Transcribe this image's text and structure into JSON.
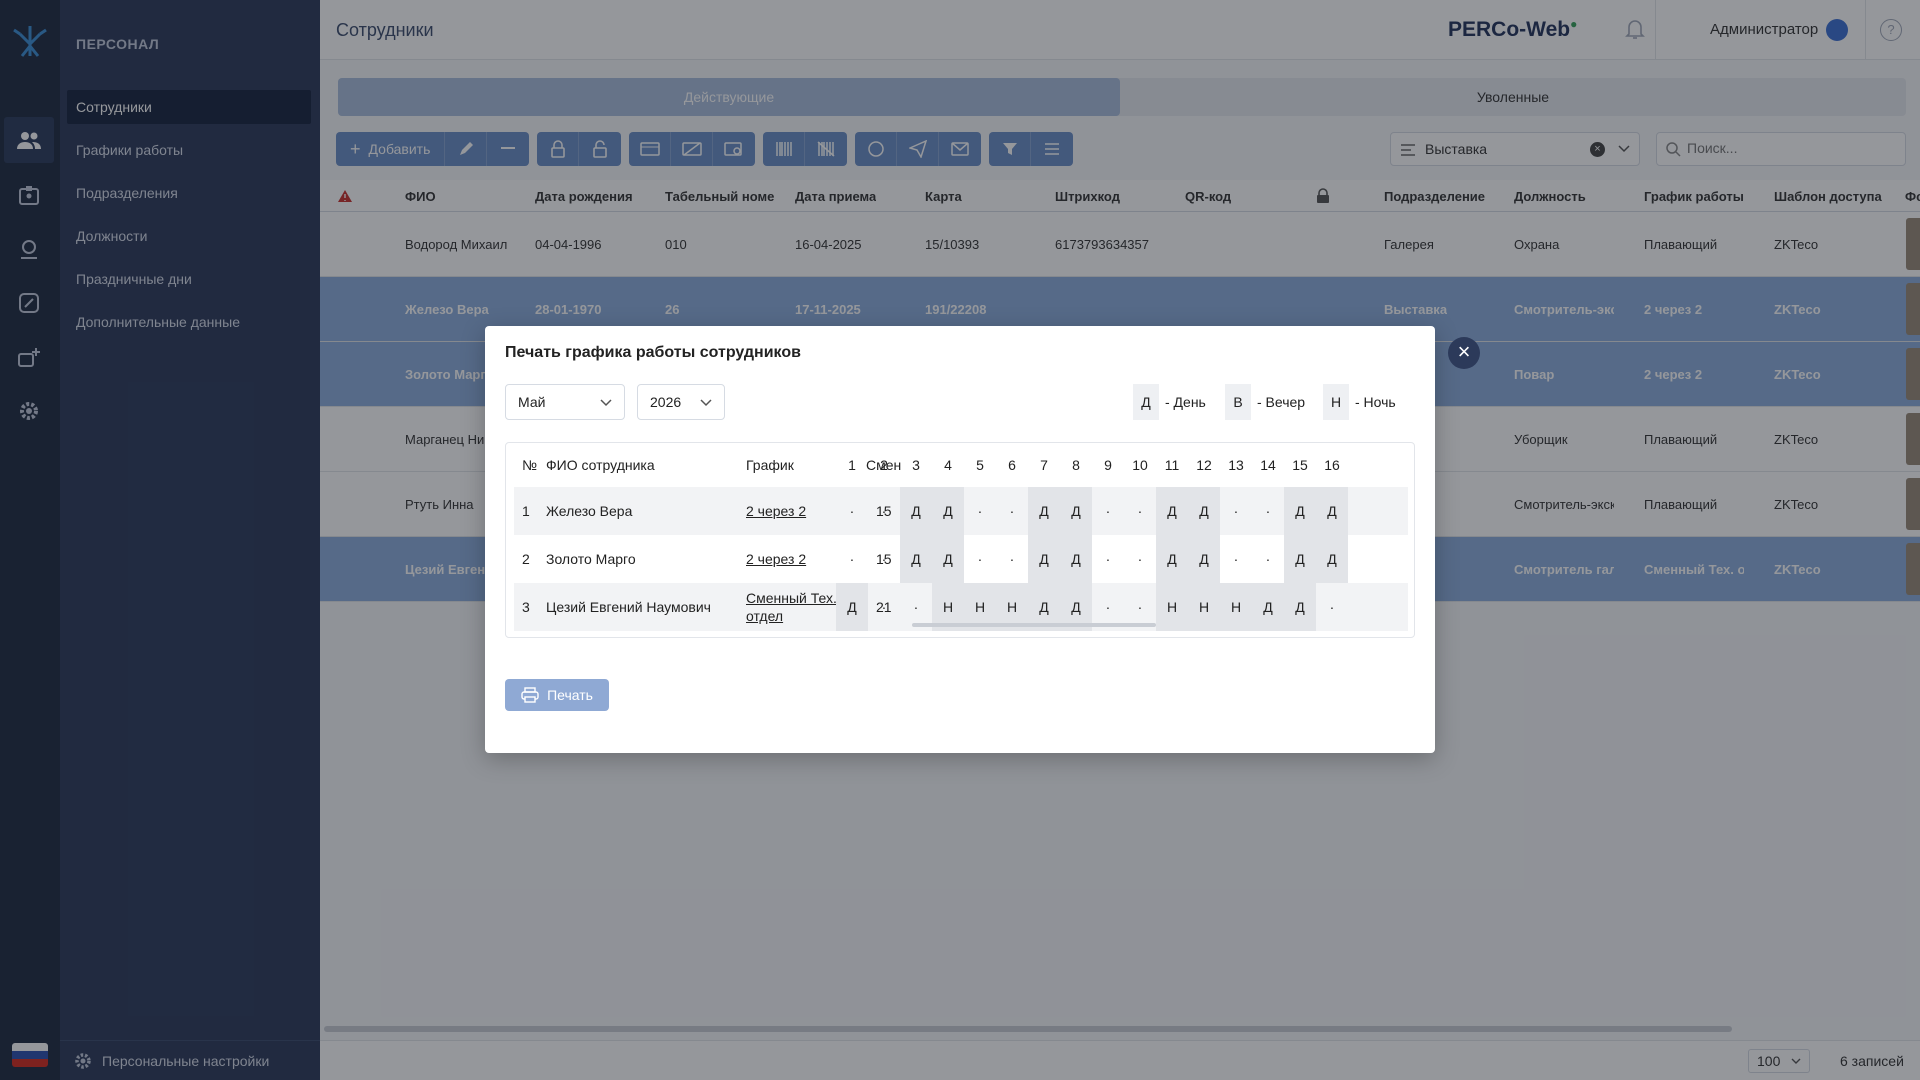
{
  "sidebar": {
    "section_title": "ПЕРСОНАЛ",
    "items": [
      {
        "label": "Сотрудники"
      },
      {
        "label": "Графики работы"
      },
      {
        "label": "Подразделения"
      },
      {
        "label": "Должности"
      },
      {
        "label": "Праздничные дни"
      },
      {
        "label": "Дополнительные данные"
      }
    ],
    "footer_label": "Персональные настройки"
  },
  "header": {
    "title": "Сотрудники",
    "brand": "PERCo-Web",
    "user": "Администратор",
    "help": "?"
  },
  "tabs": {
    "active": "Действующие",
    "inactive": "Уволенные"
  },
  "toolbar": {
    "add_label": "Добавить"
  },
  "filter": {
    "value": "Выставка"
  },
  "search": {
    "placeholder": "Поиск..."
  },
  "table": {
    "columns": [
      "ФИО",
      "Дата рождения",
      "Табельный номе",
      "Дата приема",
      "Карта",
      "Штрихкод",
      "QR-код",
      "Подразделение",
      "Должность",
      "График работы",
      "Шаблон доступа",
      "Фо"
    ],
    "rows": [
      {
        "name": "Водород Михаил",
        "birth": "04-04-1996",
        "tab": "010",
        "hire": "16-04-2025",
        "card": "15/10393",
        "barcode": "6173793634357",
        "dept": "Галерея",
        "pos": "Охрана",
        "schedule": "Плавающий",
        "access": "ZKTeco"
      },
      {
        "name": "Железо Вера",
        "birth": "28-01-1970",
        "tab": "26",
        "hire": "17-11-2025",
        "card": "191/22208",
        "barcode": "",
        "dept": "Выставка",
        "pos": "Смотритель-экскү",
        "schedule": "2 через 2",
        "access": "ZKTeco"
      },
      {
        "name": "Золото Марго",
        "birth": "",
        "tab": "",
        "hire": "",
        "card": "",
        "barcode": "",
        "dept": "",
        "pos": "Повар",
        "schedule": "2 через 2",
        "access": "ZKTeco"
      },
      {
        "name": "Марганец Ни",
        "birth": "",
        "tab": "",
        "hire": "",
        "card": "",
        "barcode": "",
        "dept": "",
        "pos": "Уборщик",
        "schedule": "Плавающий",
        "access": "ZKTeco"
      },
      {
        "name": "Ртуть Инна",
        "birth": "",
        "tab": "",
        "hire": "",
        "card": "",
        "barcode": "",
        "dept": "",
        "pos": "Смотритель-экскү",
        "schedule": "Плавающий",
        "access": "ZKTeco"
      },
      {
        "name": "Цезий Евгени",
        "birth": "",
        "tab": "",
        "hire": "",
        "card": "",
        "barcode": "",
        "dept": "",
        "pos": "Смотритель галер",
        "schedule": "Сменный Тех. отд",
        "access": "ZKTeco"
      }
    ]
  },
  "footer": {
    "page_size": "100",
    "count": "6 записей"
  },
  "modal": {
    "title": "Печать графика работы сотрудников",
    "month": "Май",
    "year": "2026",
    "legend": [
      {
        "key": "Д",
        "label": "- День"
      },
      {
        "key": "В",
        "label": "- Вечер"
      },
      {
        "key": "Н",
        "label": "- Ночь"
      }
    ],
    "columns": {
      "num": "№",
      "name": "ФИО сотрудника",
      "schedule": "График",
      "shifts": "Смен"
    },
    "days": [
      "1",
      "2",
      "3",
      "4",
      "5",
      "6",
      "7",
      "8",
      "9",
      "10",
      "11",
      "12",
      "13",
      "14",
      "15",
      "16"
    ],
    "rows": [
      {
        "num": "1",
        "name": "Железо Вера",
        "schedule": "2 через 2",
        "shifts": "15",
        "cells": [
          "·",
          "·",
          "Д",
          "Д",
          "·",
          "·",
          "Д",
          "Д",
          "·",
          "·",
          "Д",
          "Д",
          "·",
          "·",
          "Д",
          "Д"
        ]
      },
      {
        "num": "2",
        "name": "Золото Марго",
        "schedule": "2 через 2",
        "shifts": "15",
        "cells": [
          "·",
          "·",
          "Д",
          "Д",
          "·",
          "·",
          "Д",
          "Д",
          "·",
          "·",
          "Д",
          "Д",
          "·",
          "·",
          "Д",
          "Д"
        ]
      },
      {
        "num": "3",
        "name": "Цезий Евгений Наумович",
        "schedule": "Сменный Тех. отдел",
        "shifts": "21",
        "cells": [
          "Д",
          "·",
          "·",
          "Н",
          "Н",
          "Н",
          "Д",
          "Д",
          "·",
          "·",
          "Н",
          "Н",
          "Н",
          "Д",
          "Д",
          "·"
        ]
      }
    ],
    "print_label": "Печать"
  }
}
